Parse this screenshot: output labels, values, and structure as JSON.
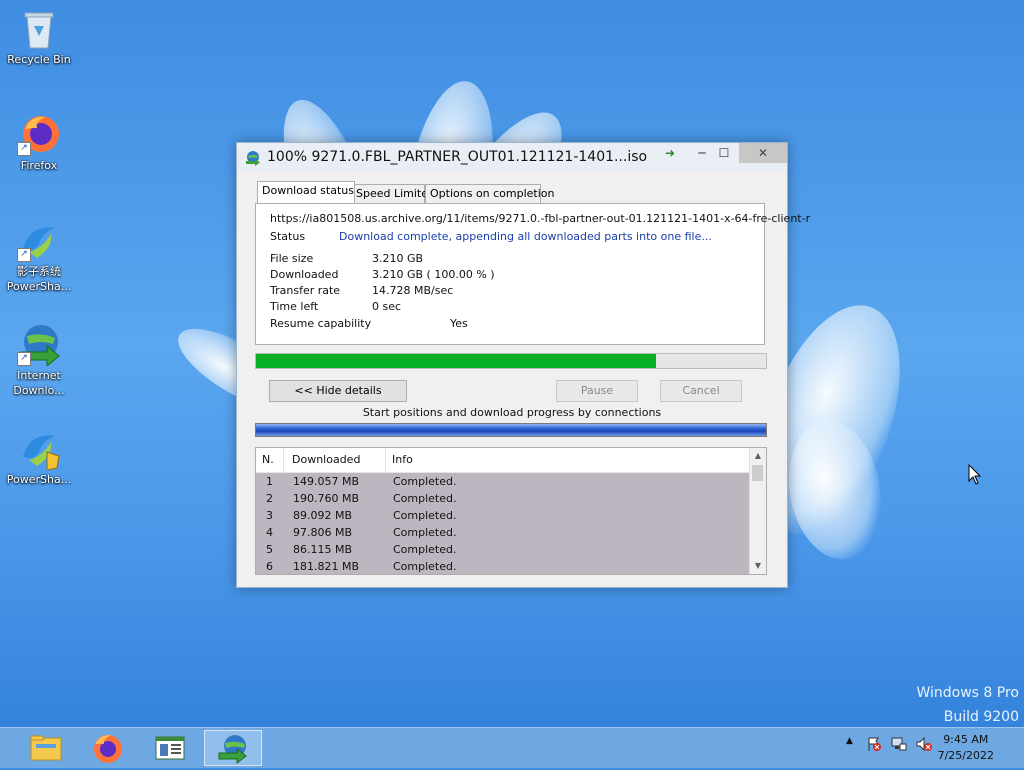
{
  "desktop": {
    "icons": [
      {
        "label": "Recycle Bin",
        "icon": "recycle-bin-icon"
      },
      {
        "label": "Firefox",
        "icon": "firefox-icon"
      },
      {
        "label": "影子系统 PowerSha...",
        "icon": "powershadow-icon"
      },
      {
        "label": "Internet Downlo...",
        "icon": "idm-icon"
      },
      {
        "label": "PowerSha...",
        "icon": "powershadow-icon"
      }
    ],
    "watermark_line1": "Windows 8 Pro",
    "watermark_line2": "Build 9200"
  },
  "window": {
    "title": "100% 9271.0.FBL_PARTNER_OUT01.121121-1401...iso",
    "controls": {
      "minimize": "─",
      "maximize": "☐",
      "close": "✕"
    },
    "tabs": [
      {
        "label": "Download status",
        "active": true
      },
      {
        "label": "Speed Limiter",
        "active": false
      },
      {
        "label": "Options on completion",
        "active": false
      }
    ],
    "url": "https://ia801508.us.archive.org/11/items/9271.0.-fbl-partner-out-01.121121-1401-x-64-fre-client-r",
    "status_label": "Status",
    "status_value": "Download complete, appending all downloaded parts into one file...",
    "fields": [
      {
        "label": "File size",
        "value": "3.210  GB"
      },
      {
        "label": "Downloaded",
        "value": "3.210  GB  ( 100.00 % )"
      },
      {
        "label": "Transfer rate",
        "value": "14.728  MB/sec"
      },
      {
        "label": "Time left",
        "value": "0 sec"
      }
    ],
    "resume_label": "Resume capability",
    "resume_value": "Yes",
    "progress_fraction": 0.785,
    "buttons": {
      "hide_details": "<< Hide details",
      "pause": "Pause",
      "cancel": "Cancel"
    },
    "connections_label": "Start positions and download progress by connections",
    "table": {
      "headers": [
        "N.",
        "Downloaded",
        "Info"
      ],
      "rows": [
        {
          "n": "1",
          "downloaded": "149.057  MB",
          "info": "Completed."
        },
        {
          "n": "2",
          "downloaded": "190.760  MB",
          "info": "Completed."
        },
        {
          "n": "3",
          "downloaded": "89.092  MB",
          "info": "Completed."
        },
        {
          "n": "4",
          "downloaded": "97.806  MB",
          "info": "Completed."
        },
        {
          "n": "5",
          "downloaded": "86.115  MB",
          "info": "Completed."
        },
        {
          "n": "6",
          "downloaded": "181.821  MB",
          "info": "Completed."
        }
      ]
    }
  },
  "taskbar": {
    "items": [
      "file-explorer-icon",
      "firefox-icon",
      "task-manager-icon",
      "idm-icon"
    ],
    "clock_time": "9:45 AM",
    "clock_date": "7/25/2022"
  }
}
